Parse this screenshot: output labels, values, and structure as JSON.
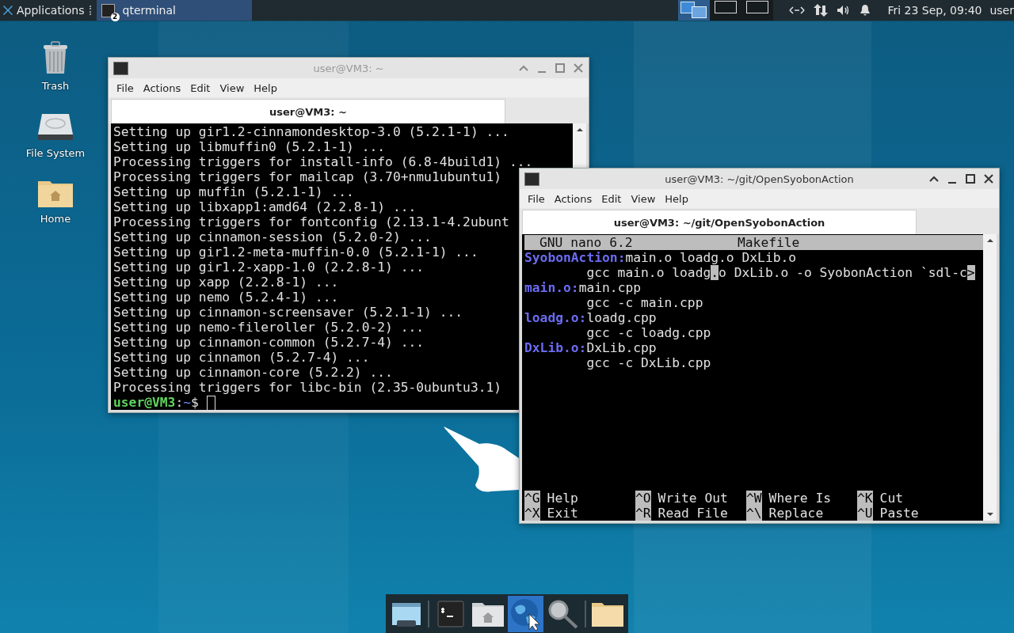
{
  "panel": {
    "menu_label": "Applications",
    "tasks": [
      {
        "label": "qterminal",
        "count": "2",
        "selected": true
      }
    ],
    "workspaces": [
      {
        "selected": true
      },
      {
        "selected": false
      },
      {
        "selected": false
      }
    ],
    "clock": "Fri 23 Sep, 09:40",
    "user": "user"
  },
  "desktop_icons": [
    {
      "kind": "trash",
      "label": "Trash"
    },
    {
      "kind": "drive",
      "label": "File System"
    },
    {
      "kind": "home",
      "label": "Home"
    }
  ],
  "windows": [
    {
      "title": "user@VM3: ~",
      "active": false,
      "menu": [
        "File",
        "Actions",
        "Edit",
        "View",
        "Help"
      ],
      "tab": "user@VM3: ~",
      "terminal": {
        "lines": [
          "Setting up gir1.2-cinnamondesktop-3.0 (5.2.1-1) ...",
          "Setting up libmuffin0 (5.2.1-1) ...",
          "Processing triggers for install-info (6.8-4build1) ...",
          "Processing triggers for mailcap (3.70+nmu1ubuntu1)",
          "Setting up muffin (5.2.1-1) ...",
          "Setting up libxapp1:amd64 (2.2.8-1) ...",
          "Processing triggers for fontconfig (2.13.1-4.2ubunt",
          "Setting up cinnamon-session (5.2.0-2) ...",
          "Setting up gir1.2-meta-muffin-0.0 (5.2.1-1) ...",
          "Setting up gir1.2-xapp-1.0 (2.2.8-1) ...",
          "Setting up xapp (2.2.8-1) ...",
          "Setting up nemo (5.2.4-1) ...",
          "Setting up cinnamon-screensaver (5.2.1-1) ...",
          "Setting up nemo-fileroller (5.2.0-2) ...",
          "Setting up cinnamon-common (5.2.7-4) ...",
          "Setting up cinnamon (5.2.7-4) ...",
          "Setting up cinnamon-core (5.2.2) ...",
          "Processing triggers for libc-bin (2.35-0ubuntu3.1)"
        ],
        "prompt": {
          "user_host": "user@VM3",
          "separator": ":",
          "path": "~",
          "symbol": "$"
        }
      }
    },
    {
      "title": "user@VM3: ~/git/OpenSyobonAction",
      "active": true,
      "menu": [
        "File",
        "Actions",
        "Edit",
        "View",
        "Help"
      ],
      "tab": "user@VM3: ~/git/OpenSyobonAction",
      "nano": {
        "app": "GNU nano 6.2",
        "file": "Makefile",
        "lines": [
          {
            "kind": "rule",
            "target": "SyobonAction:",
            "text": "main.o loadg.o DxLib.o"
          },
          {
            "kind": "command",
            "before": "gcc main.o loadg",
            "cursor": ".",
            "after": "o DxLib.o -o SyobonAction `sdl-c",
            "overflow_mark": ">"
          },
          {
            "kind": "rule",
            "target": "main.o:",
            "text": "main.cpp"
          },
          {
            "kind": "command",
            "before": "gcc -c main.cpp"
          },
          {
            "kind": "rule",
            "target": "loadg.o:",
            "text": "loadg.cpp"
          },
          {
            "kind": "command",
            "before": "gcc -c loadg.cpp"
          },
          {
            "kind": "rule",
            "target": "DxLib.o:",
            "text": "DxLib.cpp"
          },
          {
            "kind": "command",
            "before": "gcc -c DxLib.cpp"
          }
        ],
        "shortcuts": [
          {
            "key": "^G",
            "label": "Help"
          },
          {
            "key": "^O",
            "label": "Write Out"
          },
          {
            "key": "^W",
            "label": "Where Is"
          },
          {
            "key": "^K",
            "label": "Cut"
          },
          {
            "key": "^X",
            "label": "Exit"
          },
          {
            "key": "^R",
            "label": "Read File"
          },
          {
            "key": "^\\",
            "label": "Replace"
          },
          {
            "key": "^U",
            "label": "Paste"
          }
        ]
      }
    }
  ],
  "dock": [
    {
      "kind": "desktop",
      "selected": false
    },
    {
      "kind": "separator"
    },
    {
      "kind": "terminal",
      "selected": false
    },
    {
      "kind": "home",
      "selected": false
    },
    {
      "kind": "browser",
      "selected": true
    },
    {
      "kind": "search",
      "selected": false
    },
    {
      "kind": "separator"
    },
    {
      "kind": "folder",
      "selected": false
    }
  ]
}
